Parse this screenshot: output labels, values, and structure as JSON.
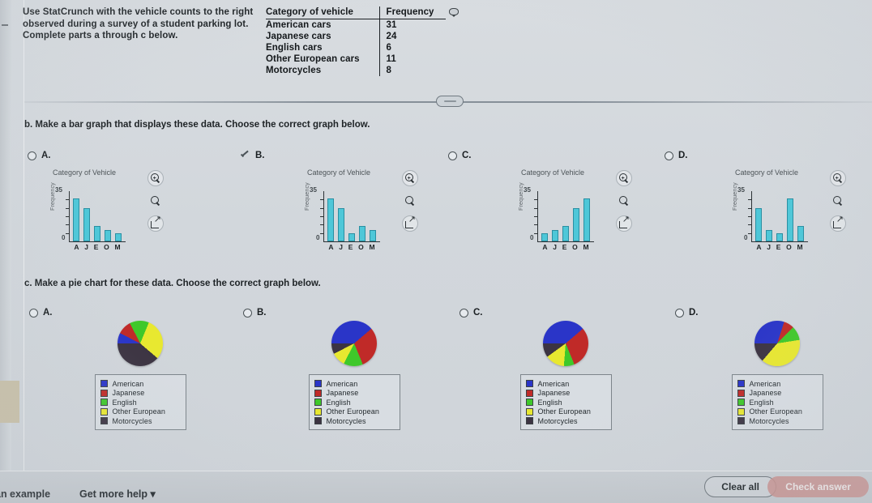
{
  "prompt": {
    "line1": "Use StatCrunch with the vehicle counts to the right",
    "line2": "observed during a survey of a student parking lot.",
    "line3": "Complete parts a through c below."
  },
  "table": {
    "header_category": "Category of vehicle",
    "header_frequency": "Frequency",
    "sort_icon": "comment-icon",
    "rows": [
      {
        "category": "American cars",
        "frequency": "31"
      },
      {
        "category": "Japanese cars",
        "frequency": "24"
      },
      {
        "category": "English cars",
        "frequency": "6"
      },
      {
        "category": "Other European cars",
        "frequency": "11"
      },
      {
        "category": "Motorcycles",
        "frequency": "8"
      }
    ]
  },
  "part_b": {
    "label": "b. Make a bar graph that displays these data. Choose the correct graph below.",
    "options": [
      {
        "letter": "A.",
        "selected": false
      },
      {
        "letter": "B.",
        "selected": true
      },
      {
        "letter": "C.",
        "selected": false
      },
      {
        "letter": "D.",
        "selected": false
      }
    ]
  },
  "part_c": {
    "label": "c. Make a pie chart for these data. Choose the correct graph below.",
    "options": [
      {
        "letter": "A.",
        "selected": false
      },
      {
        "letter": "B.",
        "selected": false
      },
      {
        "letter": "C.",
        "selected": false
      },
      {
        "letter": "D.",
        "selected": false
      }
    ]
  },
  "chart_icons": {
    "zoom_in": "magnifier-plus-icon",
    "zoom": "magnifier-icon",
    "popout": "popout-icon"
  },
  "colors": {
    "bar_fill": "#4ec7d8",
    "bar_stroke": "#2a8fa2",
    "american": "#2a35c8",
    "japanese": "#c02a28",
    "english": "#3fc82a",
    "other_european": "#e8e830",
    "motorcycles": "#3c3442",
    "check_button": "#c98f8c"
  },
  "chart_data": [
    {
      "id": "bar-a",
      "type": "bar",
      "title": "Category of Vehicle",
      "xlabel": "",
      "ylabel": "Frequency",
      "categories": [
        "A",
        "J",
        "E",
        "O",
        "M"
      ],
      "values": [
        31,
        24,
        11,
        8,
        6
      ],
      "ylim": [
        0,
        35
      ],
      "ytick_labels": [
        "0",
        "35"
      ],
      "grid": false
    },
    {
      "id": "bar-b",
      "type": "bar",
      "title": "Category of Vehicle",
      "xlabel": "",
      "ylabel": "Frequency",
      "categories": [
        "A",
        "J",
        "E",
        "O",
        "M"
      ],
      "values": [
        31,
        24,
        6,
        11,
        8
      ],
      "ylim": [
        0,
        35
      ],
      "ytick_labels": [
        "0",
        "35"
      ],
      "grid": false
    },
    {
      "id": "bar-c",
      "type": "bar",
      "title": "Category of Vehicle",
      "xlabel": "",
      "ylabel": "Frequency",
      "categories": [
        "A",
        "J",
        "E",
        "O",
        "M"
      ],
      "values": [
        6,
        8,
        11,
        24,
        31
      ],
      "ylim": [
        0,
        35
      ],
      "ytick_labels": [
        "0",
        "35"
      ],
      "grid": false
    },
    {
      "id": "bar-d",
      "type": "bar",
      "title": "Category of Vehicle",
      "xlabel": "",
      "ylabel": "Frequency",
      "categories": [
        "A",
        "J",
        "E",
        "O",
        "M"
      ],
      "values": [
        24,
        8,
        6,
        31,
        11
      ],
      "ylim": [
        0,
        35
      ],
      "ytick_labels": [
        "0",
        "35"
      ],
      "grid": false
    },
    {
      "id": "pie-a",
      "type": "pie",
      "title": "",
      "legend_position": "bottom",
      "labels": [
        "American",
        "Japanese",
        "English",
        "Other European",
        "Motorcycles"
      ],
      "values": [
        6,
        8,
        11,
        24,
        31
      ],
      "colors": [
        "#2a35c8",
        "#c02a28",
        "#3fc82a",
        "#e8e830",
        "#3c3442"
      ]
    },
    {
      "id": "pie-b",
      "type": "pie",
      "title": "",
      "legend_position": "bottom",
      "labels": [
        "American",
        "Japanese",
        "English",
        "Other European",
        "Motorcycles"
      ],
      "values": [
        31,
        24,
        11,
        8,
        6
      ],
      "colors": [
        "#2a35c8",
        "#c02a28",
        "#3fc82a",
        "#e8e830",
        "#3c3442"
      ]
    },
    {
      "id": "pie-c",
      "type": "pie",
      "title": "",
      "legend_position": "bottom",
      "labels": [
        "American",
        "Japanese",
        "English",
        "Other European",
        "Motorcycles"
      ],
      "values": [
        31,
        24,
        6,
        11,
        8
      ],
      "colors": [
        "#2a35c8",
        "#c02a28",
        "#3fc82a",
        "#e8e830",
        "#3c3442"
      ]
    },
    {
      "id": "pie-d",
      "type": "pie",
      "title": "",
      "legend_position": "bottom",
      "labels": [
        "American",
        "Japanese",
        "English",
        "Other European",
        "Motorcycles"
      ],
      "values": [
        24,
        6,
        8,
        31,
        11
      ],
      "colors": [
        "#2a35c8",
        "#c02a28",
        "#3fc82a",
        "#e8e830",
        "#3c3442"
      ]
    }
  ],
  "pie_legend_labels": [
    "American",
    "Japanese",
    "English",
    "Other European",
    "Motorcycles"
  ],
  "footer": {
    "example_link": "an example",
    "help_link": "Get more help",
    "clear_all": "Clear all",
    "check_answer": "Check answer"
  }
}
